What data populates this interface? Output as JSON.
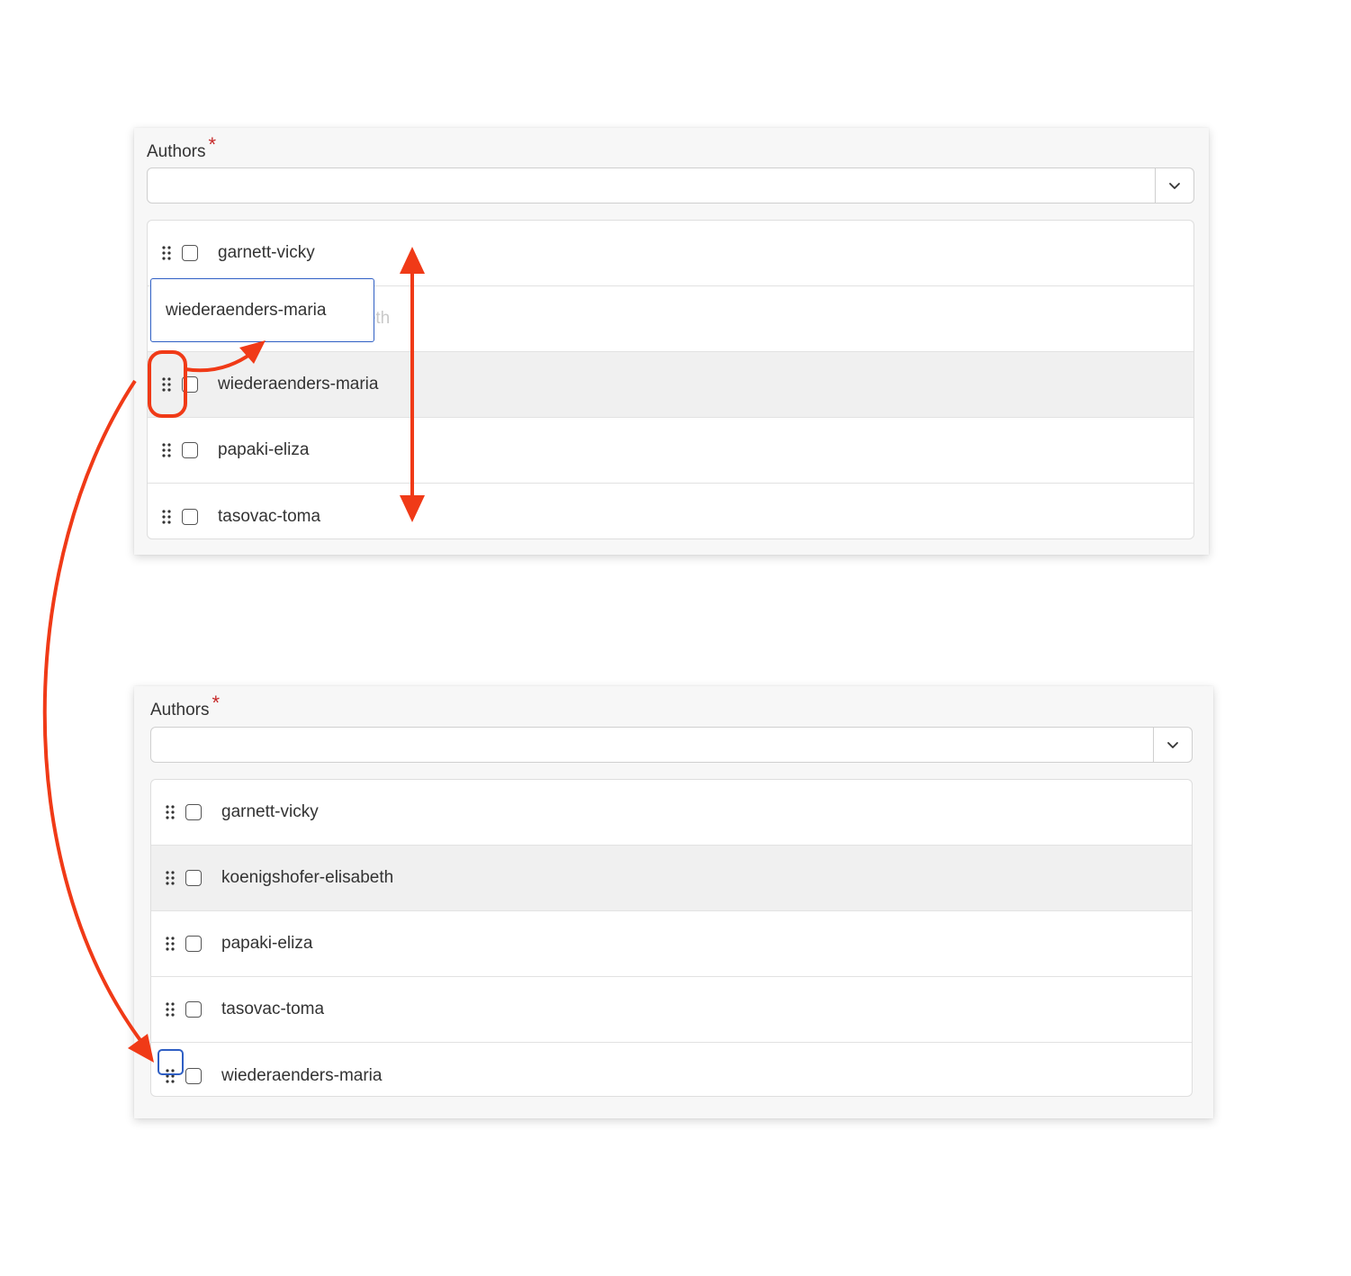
{
  "before": {
    "field_label": "Authors",
    "required_mark": "*",
    "dropdown_value": "",
    "items": [
      {
        "label": "garnett-vicky",
        "state": "normal"
      },
      {
        "label": "koenigshofer-elisabeth",
        "state": "ghost"
      },
      {
        "label": "wiederaenders-maria",
        "state": "highlight"
      },
      {
        "label": "papaki-eliza",
        "state": "normal"
      },
      {
        "label": "tasovac-toma",
        "state": "normal"
      }
    ],
    "drag_tooltip": "wiederaenders-maria"
  },
  "after": {
    "field_label": "Authors",
    "required_mark": "*",
    "dropdown_value": "",
    "items": [
      {
        "label": "garnett-vicky",
        "state": "normal"
      },
      {
        "label": "koenigshofer-elisabeth",
        "state": "highlight"
      },
      {
        "label": "papaki-eliza",
        "state": "normal"
      },
      {
        "label": "tasovac-toma",
        "state": "normal"
      },
      {
        "label": "wiederaenders-maria",
        "state": "normal"
      }
    ]
  },
  "annotation_color": "#f03a17",
  "focus_color": "#2f5fc4",
  "icons": {
    "drag_handle": "grip-dots-icon",
    "dropdown": "chevron-down-icon"
  }
}
